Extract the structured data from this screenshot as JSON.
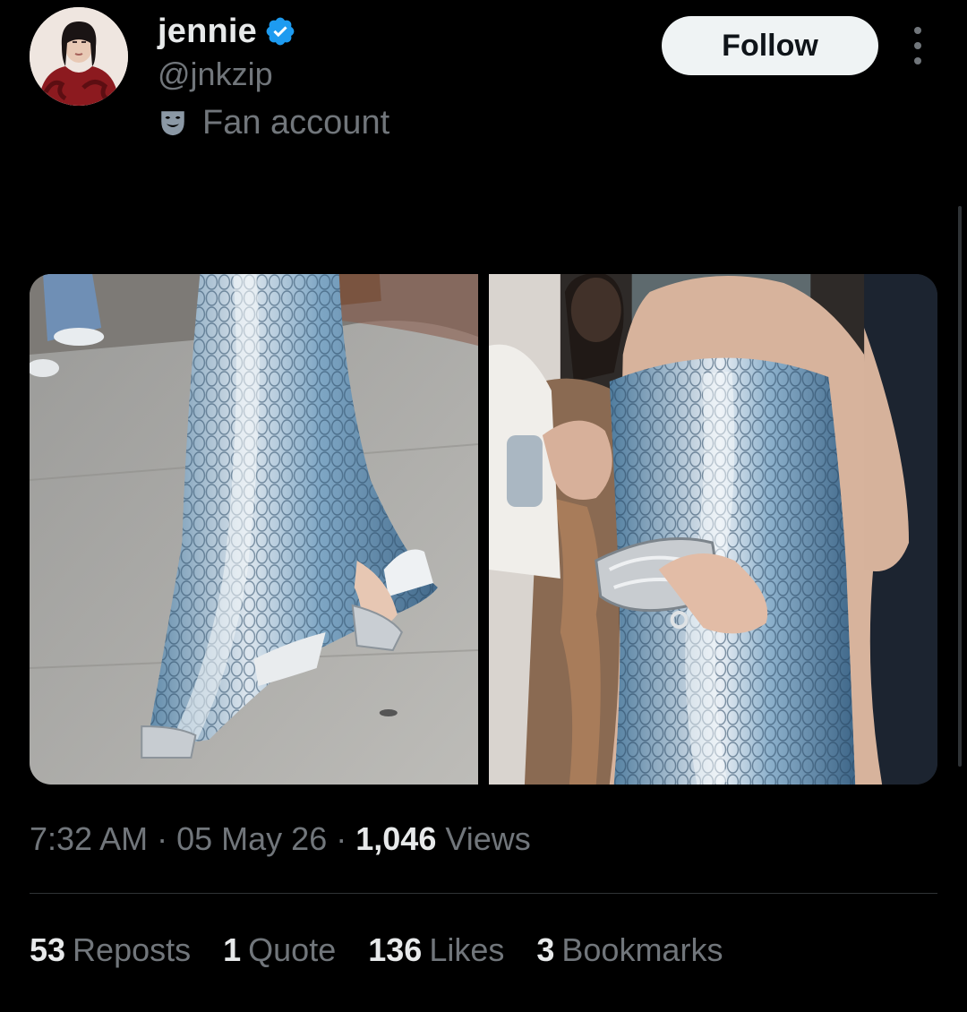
{
  "author": {
    "display_name": "jennie",
    "handle": "@jnkzip",
    "label": "Fan account",
    "verified": true
  },
  "actions": {
    "follow_label": "Follow"
  },
  "icons": {
    "verified": "verified-badge-icon",
    "label": "theater-mask-icon",
    "more": "more-dots-icon"
  },
  "media": {
    "count": 2
  },
  "meta": {
    "time": "7:32 AM",
    "separator": "·",
    "date": "05 May 26",
    "views_count": "1,046",
    "views_label": "Views"
  },
  "stats": [
    {
      "count": "53",
      "label": "Reposts"
    },
    {
      "count": "1",
      "label": "Quote"
    },
    {
      "count": "136",
      "label": "Likes"
    },
    {
      "count": "3",
      "label": "Bookmarks"
    }
  ],
  "colors": {
    "background": "#000000",
    "primary_text": "#e7e9ea",
    "secondary_text": "#71767b",
    "verified_blue": "#1d9bf0",
    "follow_bg": "#eff3f4"
  }
}
